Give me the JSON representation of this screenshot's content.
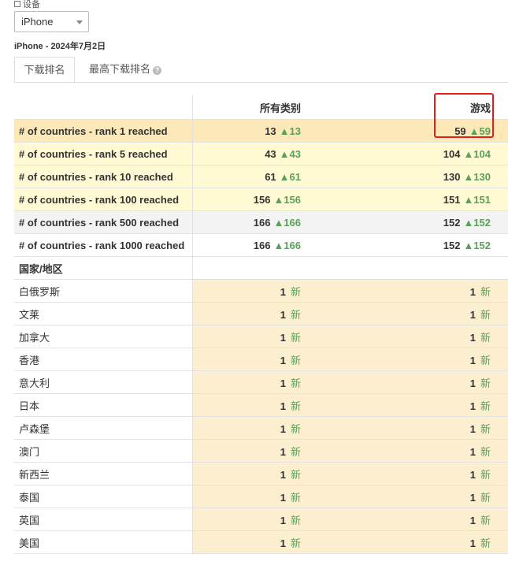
{
  "device": {
    "label": "设备",
    "selected": "iPhone"
  },
  "subtitle": "iPhone - 2024年7月2日",
  "tabs": [
    {
      "label": "下载排名",
      "active": true
    },
    {
      "label": "最高下载排名",
      "active": false
    }
  ],
  "table": {
    "columns": [
      "所有类别",
      "游戏"
    ],
    "rows": [
      {
        "label": "# of countries - rank 1 reached",
        "all": "13",
        "all_delta": "▲13",
        "games": "59",
        "games_delta": "▲59"
      },
      {
        "label": "# of countries - rank 5 reached",
        "all": "43",
        "all_delta": "▲43",
        "games": "104",
        "games_delta": "▲104"
      },
      {
        "label": "# of countries - rank 10 reached",
        "all": "61",
        "all_delta": "▲61",
        "games": "130",
        "games_delta": "▲130"
      },
      {
        "label": "# of countries - rank 100 reached",
        "all": "156",
        "all_delta": "▲156",
        "games": "151",
        "games_delta": "▲151"
      },
      {
        "label": "# of countries - rank 500 reached",
        "all": "166",
        "all_delta": "▲166",
        "games": "152",
        "games_delta": "▲152"
      },
      {
        "label": "# of countries - rank 1000 reached",
        "all": "166",
        "all_delta": "▲166",
        "games": "152",
        "games_delta": "▲152"
      }
    ],
    "section_label": "国家/地区",
    "countries": [
      {
        "name": "白俄罗斯",
        "all": "1",
        "games": "1",
        "tag": "新"
      },
      {
        "name": "文莱",
        "all": "1",
        "games": "1",
        "tag": "新"
      },
      {
        "name": "加拿大",
        "all": "1",
        "games": "1",
        "tag": "新"
      },
      {
        "name": "香港",
        "all": "1",
        "games": "1",
        "tag": "新"
      },
      {
        "name": "意大利",
        "all": "1",
        "games": "1",
        "tag": "新"
      },
      {
        "name": "日本",
        "all": "1",
        "games": "1",
        "tag": "新"
      },
      {
        "name": "卢森堡",
        "all": "1",
        "games": "1",
        "tag": "新"
      },
      {
        "name": "澳门",
        "all": "1",
        "games": "1",
        "tag": "新"
      },
      {
        "name": "新西兰",
        "all": "1",
        "games": "1",
        "tag": "新"
      },
      {
        "name": "泰国",
        "all": "1",
        "games": "1",
        "tag": "新"
      },
      {
        "name": "英国",
        "all": "1",
        "games": "1",
        "tag": "新"
      },
      {
        "name": "美国",
        "all": "1",
        "games": "1",
        "tag": "新"
      }
    ]
  },
  "colors": {
    "up": "#5aa05a",
    "highlight": "#e02020",
    "rank1_bg": "#fde8b8",
    "rank_bg": "#fff9d4",
    "country_bg": "#fbefcf"
  }
}
